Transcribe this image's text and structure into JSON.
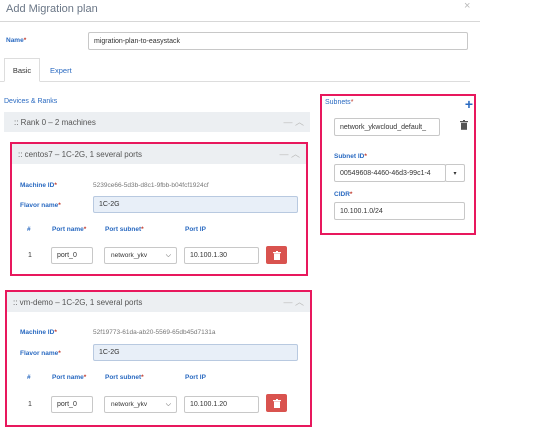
{
  "dialog": {
    "title": "Add Migration plan",
    "close_label": "×"
  },
  "plan": {
    "name_label": "Name",
    "name_required": "*",
    "name_value": "migration-plan-to-easystack"
  },
  "tabs": [
    {
      "label": "Basic"
    },
    {
      "label": "Expert"
    }
  ],
  "devices": {
    "section_label": "Devices & Ranks",
    "rank_label": ":: Rank 0 – 2 machines",
    "machines": [
      {
        "header": ":: centos7 – 1C-2G, 1 several ports",
        "machine_id_label": "Machine ID",
        "machine_id_value": "5239ce66-5d3b-d8c1-9fbb-b04fcf1924cf",
        "flavor_label": "Flavor name",
        "flavor_value": "1C-2G",
        "col_num": "#",
        "col_port_name": "Port name",
        "col_port_subnet": "Port subnet",
        "col_port_ip": "Port IP",
        "port": {
          "index": "1",
          "name": "port_0",
          "subnet": "network_ykv",
          "ip": "10.100.1.30"
        }
      },
      {
        "header": ":: vm-demo – 1C-2G, 1 several ports",
        "machine_id_label": "Machine ID",
        "machine_id_value": "52f19773-61da-ab20-5569-65db45d7131a",
        "flavor_label": "Flavor name",
        "flavor_value": "1C-2G",
        "col_num": "#",
        "col_port_name": "Port name",
        "col_port_subnet": "Port subnet",
        "col_port_ip": "Port IP",
        "port": {
          "index": "1",
          "name": "port_0",
          "subnet": "network_ykv",
          "ip": "10.100.1.20"
        }
      }
    ]
  },
  "subnets": {
    "section_label": "Subnets",
    "add_label": "+",
    "name_value": "network_ykwcloud_default_",
    "subnet_id_label": "Subnet ID",
    "subnet_id_value": "00549608-4460-46d3-99c1-4",
    "cidr_label": "CIDR",
    "cidr_value": "10.100.1.0/24"
  },
  "required_mark": "*",
  "colors": {
    "accent": "#2a6ac1",
    "highlight": "#e8185d",
    "danger": "#d9534f"
  }
}
